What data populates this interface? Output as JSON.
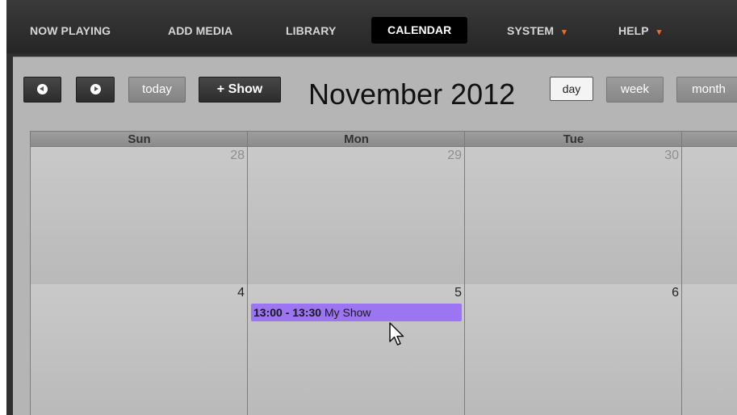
{
  "nav": {
    "items": [
      {
        "label": "NOW PLAYING"
      },
      {
        "label": "ADD MEDIA"
      },
      {
        "label": "LIBRARY"
      },
      {
        "label": "CALENDAR",
        "active": true
      },
      {
        "label": "SYSTEM",
        "dropdown": true
      },
      {
        "label": "HELP",
        "dropdown": true
      }
    ],
    "caret": "▾",
    "accent": "#f16a20"
  },
  "toolbar": {
    "today_label": "today",
    "add_show_label": "Show",
    "add_show_plus": "+",
    "title": "November 2012",
    "views": [
      "day",
      "week",
      "month"
    ],
    "active_view": "day"
  },
  "calendar": {
    "weekdays": [
      "Sun",
      "Mon",
      "Tue"
    ],
    "rows": [
      [
        {
          "day": "28",
          "other_month": true
        },
        {
          "day": "29",
          "other_month": true
        },
        {
          "day": "30",
          "other_month": true
        }
      ],
      [
        {
          "day": "4"
        },
        {
          "day": "5"
        },
        {
          "day": "6"
        }
      ]
    ]
  },
  "event": {
    "time": "13:00 - 13:30",
    "title": "My Show",
    "color": "#9b75f2"
  },
  "icons": {
    "prev": "chevron-left-circle-icon",
    "next": "chevron-right-circle-icon",
    "cursor": "mouse-pointer-icon"
  }
}
